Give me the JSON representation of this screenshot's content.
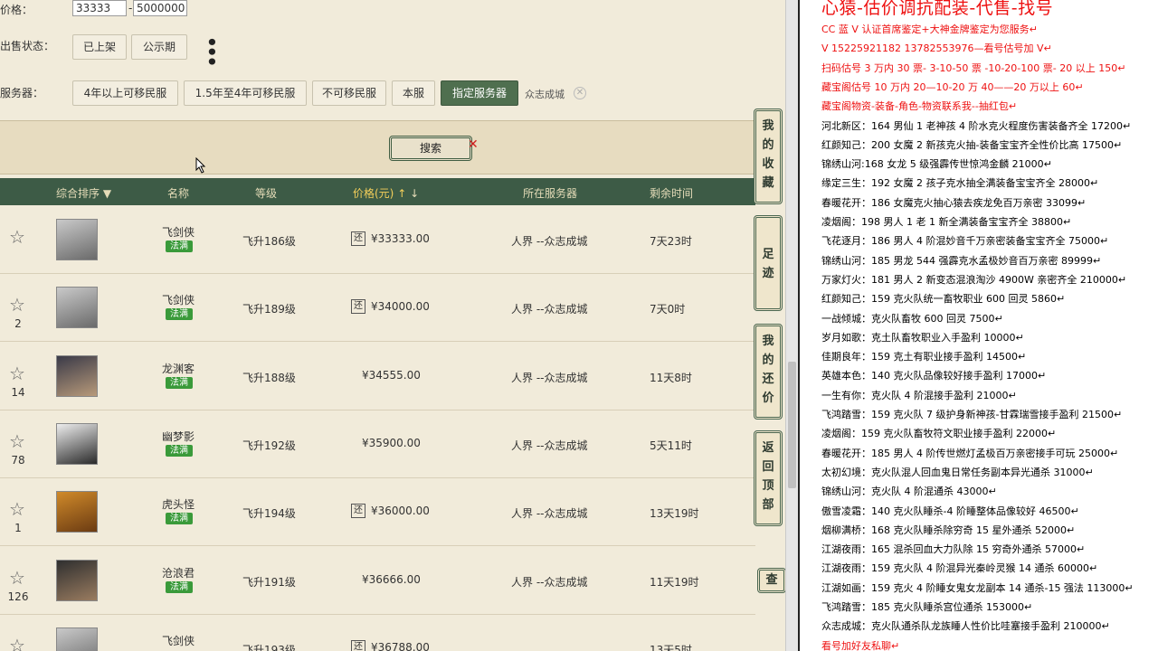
{
  "filters": {
    "price_label": "价格：",
    "price_min": "33333",
    "price_sep": "-",
    "price_max": "5000000",
    "status_label": "出售状态：",
    "status_options": [
      "已上架",
      "公示期"
    ],
    "server_label": "服务器：",
    "server_options": [
      "4年以上可移民服",
      "1.5年至4年可移民服",
      "不可移民服",
      "本服",
      "指定服务器"
    ],
    "server_tag": "众志成城",
    "search_label": "搜索"
  },
  "table": {
    "headers": [
      "综合排序",
      "名称",
      "等级",
      "价格(元)",
      "所在服务器",
      "剩余时间"
    ],
    "rows": [
      {
        "fav": "",
        "name": "飞剑侠",
        "badge": "法满",
        "level": "飞升186级",
        "rt": "还",
        "price": "¥33333.00",
        "server": "人界 --众志成城",
        "time": "7天23时"
      },
      {
        "fav": "2",
        "name": "飞剑侠",
        "badge": "法满",
        "level": "飞升189级",
        "rt": "还",
        "price": "¥34000.00",
        "server": "人界 --众志成城",
        "time": "7天0时"
      },
      {
        "fav": "14",
        "name": "龙渊客",
        "badge": "法满",
        "level": "飞升188级",
        "rt": "",
        "price": "¥34555.00",
        "server": "人界 --众志成城",
        "time": "11天8时"
      },
      {
        "fav": "78",
        "name": "幽梦影",
        "badge": "法满",
        "level": "飞升192级",
        "rt": "",
        "price": "¥35900.00",
        "server": "人界 --众志成城",
        "time": "5天11时"
      },
      {
        "fav": "1",
        "name": "虎头怪",
        "badge": "法满",
        "level": "飞升194级",
        "rt": "还",
        "price": "¥36000.00",
        "server": "人界 --众志成城",
        "time": "13天19时"
      },
      {
        "fav": "126",
        "name": "沧浪君",
        "badge": "法满",
        "level": "飞升191级",
        "rt": "",
        "price": "¥36666.00",
        "server": "人界 --众志成城",
        "time": "11天19时"
      },
      {
        "fav": "",
        "name": "飞剑侠",
        "badge": "",
        "level": "飞升193级",
        "rt": "还",
        "price": "¥36788.00",
        "server": "",
        "time": "13天5时"
      }
    ]
  },
  "side_buttons": [
    "我的收藏",
    "足迹",
    "我的还价",
    "返回顶部",
    "查"
  ],
  "notes": [
    {
      "text": "心猿-估价调抗配装-代售-找号",
      "red": true,
      "big": true
    },
    {
      "text": "CC 蓝 V 认证首席鉴定+大神金牌鉴定为您服务↵",
      "red": true
    },
    {
      "text": "V 15225921182     13782553976—看号估号加 V↵",
      "red": true
    },
    {
      "text": "扫码估号 3 万内 30 票- 3-10-50 票  -10-20-100 票- 20 以上 150↵",
      "red": true
    },
    {
      "text": "藏宝阁估号 10 万内 20—10-20 万 40——20 万以上 60↵",
      "red": true
    },
    {
      "text": "藏宝阁物资-装备-角色-物资联系我--抽红包↵",
      "red": true
    },
    {
      "text": "河北新区：164 男仙 1 老神孩 4 阶水克火程度伤害装备齐全 17200↵",
      "red": false
    },
    {
      "text": "红颜知己：200 女魔 2 新孩克火抽-装备宝宝齐全性价比高 17500↵",
      "red": false
    },
    {
      "text": "锦绣山河:168 女龙 5 级强霹传世惊鸿金麟 21000↵",
      "red": false
    },
    {
      "text": "缘定三生：192 女魔 2 孩子克水抽全满装备宝宝齐全 28000↵",
      "red": false
    },
    {
      "text": "春暖花开：186 女魔克火抽心猿去疾龙免百万亲密 33099↵",
      "red": false
    },
    {
      "text": "凌烟阁：198 男人 1 老 1 新全满装备宝宝齐全 38800↵",
      "red": false
    },
    {
      "text": "飞花逐月：186 男人 4 阶混妙音千万亲密装备宝宝齐全 75000↵",
      "red": false
    },
    {
      "text": "锦绣山河：185 男龙 544 强霹克水孟极妙音百万亲密 89999↵",
      "red": false
    },
    {
      "text": "万家灯火：181 男人 2 新变态混浪淘沙 4900W 亲密齐全 210000↵",
      "red": false
    },
    {
      "text": "红颜知己：159 克火队统一畜牧职业 600 回灵 5860↵",
      "red": false
    },
    {
      "text": "一战倾城：克火队畜牧 600 回灵 7500↵",
      "red": false
    },
    {
      "text": "岁月如歌：克土队畜牧职业入手盈利 10000↵",
      "red": false
    },
    {
      "text": "佳期良年：159 克土有职业接手盈利 14500↵",
      "red": false
    },
    {
      "text": "英雄本色：140 克火队品像较好接手盈利 17000↵",
      "red": false
    },
    {
      "text": "一生有你：克火队 4 阶混接手盈利 21000↵",
      "red": false
    },
    {
      "text": "飞鸿踏雪：159 克火队 7 级护身新神孩-甘霖瑞雪接手盈利 21500↵",
      "red": false
    },
    {
      "text": "凌烟阁：159 克火队畜牧符文职业接手盈利 22000↵",
      "red": false
    },
    {
      "text": "春暖花开：185 男人 4 阶传世燃灯孟极百万亲密接手可玩 25000↵",
      "red": false
    },
    {
      "text": "太初幻境：克火队混人回血鬼日常任务副本异光通杀 31000↵",
      "red": false
    },
    {
      "text": "锦绣山河：克火队 4 阶混通杀 43000↵",
      "red": false
    },
    {
      "text": "傲雪凌霜：140 克火队睡杀-4 阶睡整体品像较好 46500↵",
      "red": false
    },
    {
      "text": "烟柳满桥：168 克火队睡杀除穷奇 15 星外通杀 52000↵",
      "red": false
    },
    {
      "text": "江湖夜雨：165 混杀回血大力队除 15 穷奇外通杀 57000↵",
      "red": false
    },
    {
      "text": "江湖夜雨：159 克火队 4 阶混异光秦岭灵猴 14 通杀 60000↵",
      "red": false
    },
    {
      "text": "江湖如画：159 克火 4 阶睡女鬼女龙副本 14 通杀-15 强法 113000↵",
      "red": false
    },
    {
      "text": "飞鸿踏雪：185 克火队睡杀宫位通杀 153000↵",
      "red": false
    },
    {
      "text": "众志成城：克火队通杀队龙族睡人性价比哇塞接手盈利 210000↵",
      "red": false
    },
    {
      "text": "看号加好友私聊↵",
      "red": true
    }
  ]
}
